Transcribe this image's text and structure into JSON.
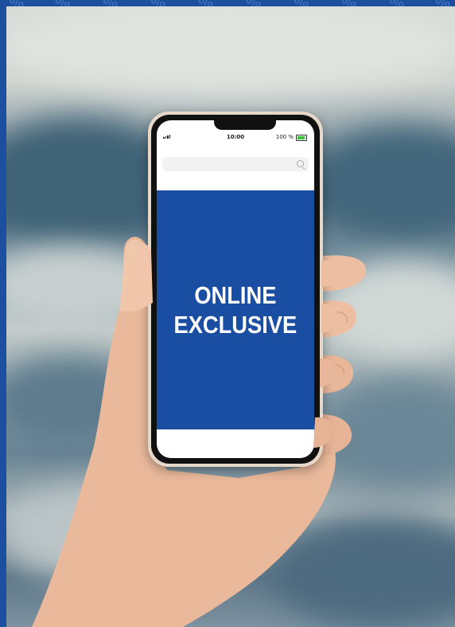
{
  "banner": {
    "line1": "ONLINE",
    "line2": "EXCLUSIVE"
  },
  "phone_status": {
    "time": "10:00",
    "battery": "100 %"
  },
  "colors": {
    "brand_blue": "#1a4ea3",
    "frame_blue": "#1c4fa0"
  },
  "icons": {
    "search": "search-icon",
    "signal": "signal-icon",
    "battery": "battery-icon"
  }
}
